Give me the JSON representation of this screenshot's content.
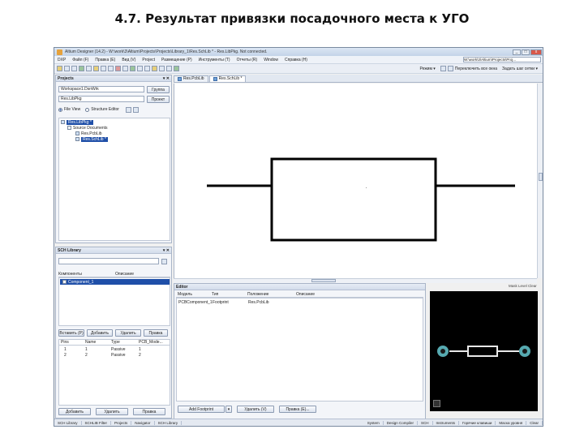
{
  "slide": {
    "title": "4.7. Результат привязки посадочного места к УГО"
  },
  "window": {
    "title": "Altium Designer (14.2) - W:\\work\\3\\Altium\\Projects\\Projects\\Library_1\\Res.SchLib * - Res.LibPkg. Not connected.",
    "min": "_",
    "max": "□",
    "close": "x"
  },
  "menu": {
    "items": [
      "DXP",
      "Файл (F)",
      "Правка (E)",
      "Вид (V)",
      "Project",
      "Размещение (P)",
      "Инструменты (T)",
      "Отчеты (R)",
      "Window",
      "Справка (H)"
    ],
    "path": "W:\\work\\3\\Altium\\Projects\\Proj..."
  },
  "toolbar": {
    "right_items": [
      "Режим ▾",
      "Переключить все окна",
      "Задать шаг сетки ▾"
    ]
  },
  "projects_panel": {
    "title": "Projects",
    "workspace": "Workspace1.DsnWrk",
    "workspace_btn": "Группа",
    "project": "Res.LibPkg",
    "project_btn": "Проект",
    "view_file": "File View",
    "view_structure": "Structure Editor",
    "tree": [
      "Res.LibPkg *",
      "Source Documents",
      "Res.PcbLib",
      "Res.SchLib *"
    ]
  },
  "scl_panel": {
    "title": "SCH Library",
    "col_components": "Компоненты",
    "col_description": "Описание",
    "components": [
      "Component_1"
    ],
    "buttons": [
      "Вставить (P)",
      "Добавить",
      "Удалить",
      "Правка"
    ],
    "pin_headers": [
      "Pins",
      "Name",
      "Type",
      "PCB_Mode..."
    ],
    "pins": [
      {
        "pin": "1",
        "name": "1",
        "type": "Passive",
        "pcb": "1"
      },
      {
        "pin": "2",
        "name": "2",
        "type": "Passive",
        "pcb": "2"
      }
    ],
    "pin_buttons": [
      "Добавить",
      "Удалить",
      "Правка"
    ]
  },
  "tabs": [
    "Res.PcbLib",
    "Res.SchLib *"
  ],
  "canvas_status": "Mask Level  Clear",
  "editor": {
    "title": "Editor",
    "headers": [
      "Модель",
      "Тип",
      "Положение",
      "Описание"
    ],
    "rows": [
      {
        "model": "PCBComponent_1",
        "type": "Footprint",
        "location": "Res.PcbLib",
        "description": ""
      }
    ],
    "buttons": [
      "Add Footprint",
      "Удалить (V)",
      "Правка (E)..."
    ]
  },
  "bottom_bar": {
    "left": [
      "SCH Library",
      "SCHLIB Filter",
      "Projects",
      "Navigator",
      "SCH Library"
    ],
    "right": [
      "System",
      "Design Compiler",
      "SCH",
      "Instruments",
      "Горячие клавиши",
      "Маска уровня",
      "Clear"
    ]
  }
}
